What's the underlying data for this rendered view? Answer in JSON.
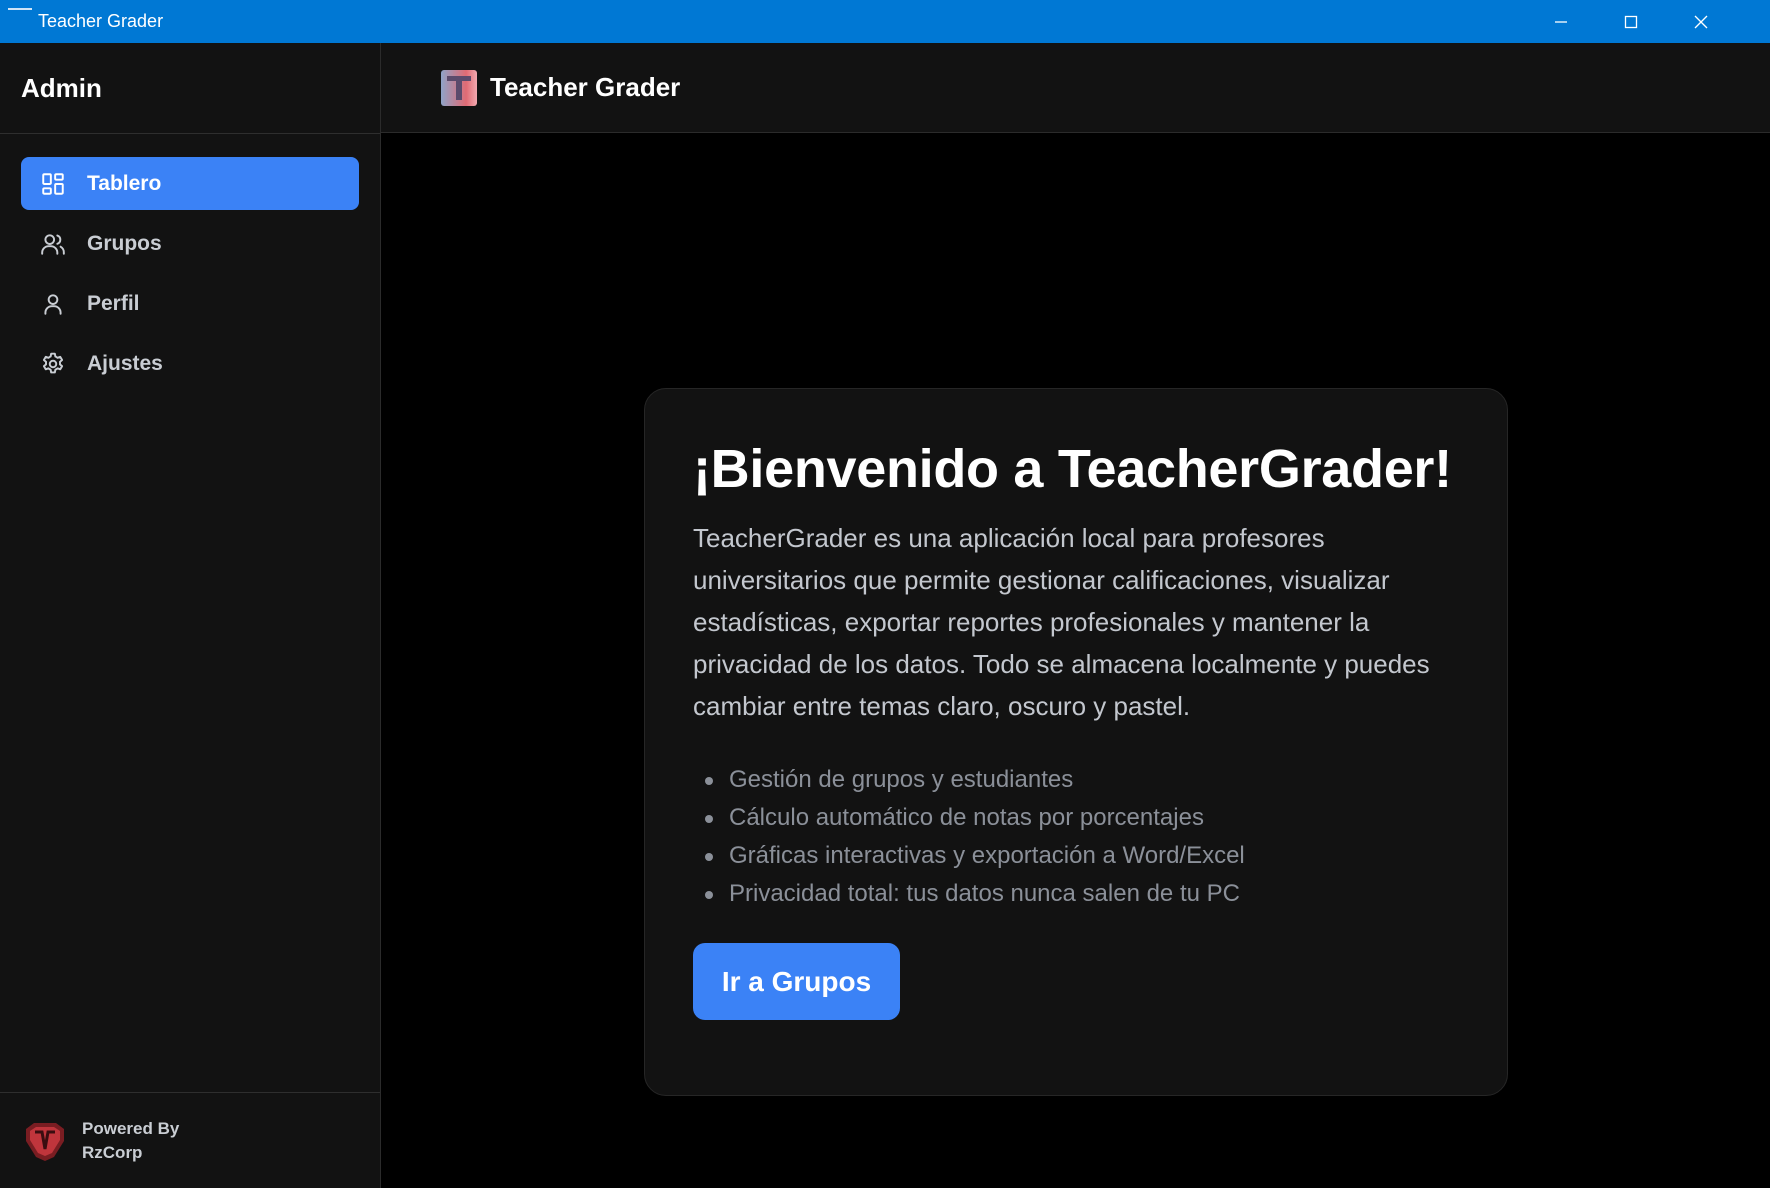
{
  "window": {
    "title": "Teacher Grader",
    "controls": [
      "minimize-icon",
      "maximize-icon",
      "close-icon"
    ]
  },
  "sidebar": {
    "header": "Admin",
    "items": [
      {
        "label": "Tablero",
        "icon": "dashboard-grid-icon",
        "active": true
      },
      {
        "label": "Grupos",
        "icon": "users-icon",
        "active": false
      },
      {
        "label": "Perfil",
        "icon": "user-icon",
        "active": false
      },
      {
        "label": "Ajustes",
        "icon": "gear-icon",
        "active": false
      }
    ],
    "footer": {
      "line1": "Powered By",
      "line2": "RzCorp"
    }
  },
  "topbar": {
    "title": "Teacher Grader"
  },
  "welcome": {
    "heading": "¡Bienvenido a TeacherGrader!",
    "description": "TeacherGrader es una aplicación local para profesores universitarios que permite gestionar calificaciones, visualizar estadísticas, exportar reportes profesionales y mantener la privacidad de los datos. Todo se almacena localmente y puedes cambiar entre temas claro, oscuro y pastel.",
    "features": [
      "Gestión de grupos y estudiantes",
      "Cálculo automático de notas por porcentajes",
      "Gráficas interactivas y exportación a Word/Excel",
      "Privacidad total: tus datos nunca salen de tu PC"
    ],
    "button_label": "Ir a Grupos"
  },
  "colors": {
    "titlebar": "#0078d4",
    "accent": "#3b82f6",
    "sidebar_bg": "#121212",
    "main_bg": "#000000"
  }
}
